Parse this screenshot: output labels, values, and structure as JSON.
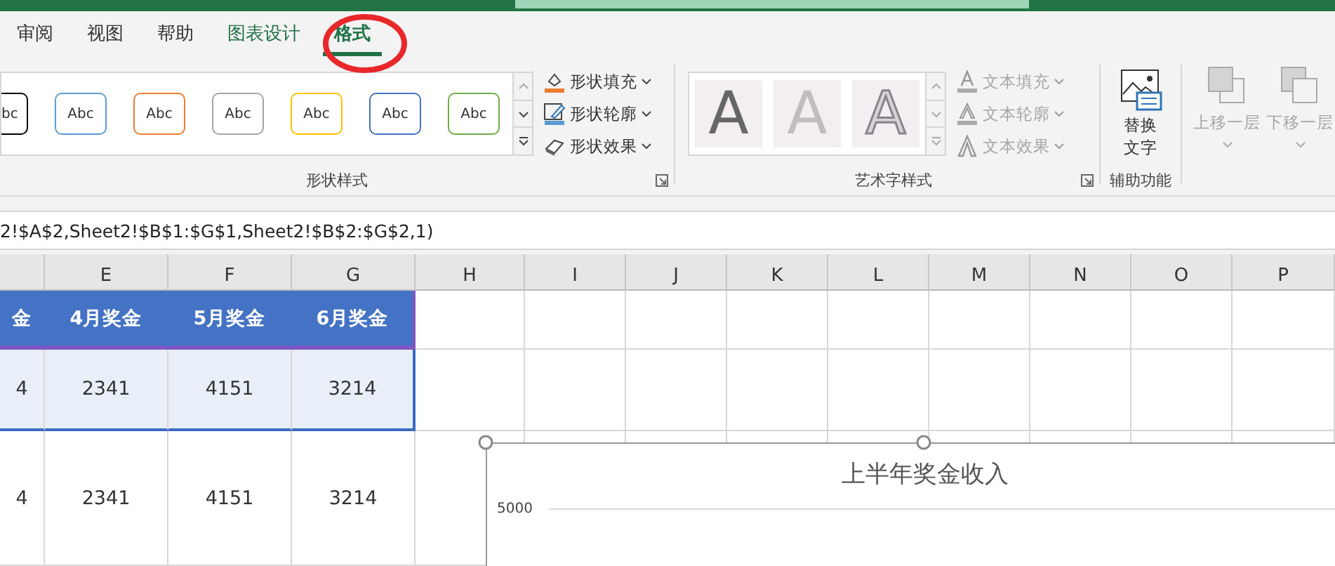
{
  "ribbon_tabs": [
    {
      "label": "审阅",
      "selected": false,
      "kind": "plain"
    },
    {
      "label": "视图",
      "selected": false,
      "kind": "plain"
    },
    {
      "label": "帮助",
      "selected": false,
      "kind": "plain"
    },
    {
      "label": "图表设计",
      "selected": false,
      "kind": "context"
    },
    {
      "label": "格式",
      "selected": true,
      "kind": "context"
    }
  ],
  "shape_styles": {
    "label": "形状样式",
    "gallery": [
      {
        "text": "bc",
        "color": "#000000"
      },
      {
        "text": "Abc",
        "color": "#5b9bd5"
      },
      {
        "text": "Abc",
        "color": "#ed7d31"
      },
      {
        "text": "Abc",
        "color": "#a5a5a5"
      },
      {
        "text": "Abc",
        "color": "#ffc000"
      },
      {
        "text": "Abc",
        "color": "#4472c4"
      },
      {
        "text": "Abc",
        "color": "#70ad47"
      }
    ],
    "commands": [
      {
        "label": "形状填充",
        "kind": "fill",
        "disabled": false
      },
      {
        "label": "形状轮廓",
        "kind": "outline",
        "disabled": false
      },
      {
        "label": "形状效果",
        "kind": "effect",
        "disabled": false
      }
    ]
  },
  "wordart_styles": {
    "label": "艺术字样式",
    "gallery": [
      {
        "text": "A",
        "kind": "fill"
      },
      {
        "text": "A",
        "kind": "soft"
      },
      {
        "text": "A",
        "kind": "outline"
      }
    ],
    "commands": [
      {
        "label": "文本填充",
        "kind": "fill",
        "disabled": true
      },
      {
        "label": "文本轮廓",
        "kind": "outline",
        "disabled": true
      },
      {
        "label": "文本效果",
        "kind": "effect",
        "disabled": true
      }
    ]
  },
  "accessibility": {
    "label": "辅助功能",
    "button": "替换文字"
  },
  "arrange": {
    "buttons": [
      {
        "label": "上移一层",
        "kind": "forward",
        "disabled": true
      },
      {
        "label": "下移一层",
        "kind": "backward",
        "disabled": true
      }
    ]
  },
  "formula_bar": {
    "text": "2!$A$2,Sheet2!$B$1:$G$1,Sheet2!$B$2:$G$2,1)"
  },
  "sheet": {
    "columns": [
      "",
      "E",
      "F",
      "G",
      "H",
      "I",
      "J",
      "K",
      "L",
      "M",
      "N",
      "O",
      "P"
    ],
    "rows": [
      {
        "kind": "series_names",
        "cells": [
          "金",
          "4月奖金",
          "5月奖金",
          "6月奖金"
        ]
      },
      {
        "kind": "values",
        "cells": [
          "4",
          "2341",
          "4151",
          "3214"
        ]
      },
      {
        "kind": "plain",
        "cells": [
          "4",
          "2341",
          "4151",
          "3214"
        ]
      }
    ]
  },
  "chart": {
    "title": "上半年奖金收入",
    "y_tick": "5000"
  }
}
